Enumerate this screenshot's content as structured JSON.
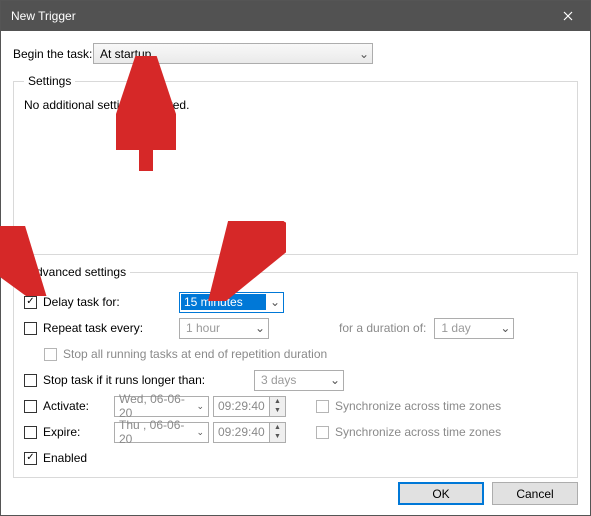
{
  "window": {
    "title": "New Trigger"
  },
  "begin": {
    "label": "Begin the task:",
    "value": "At startup"
  },
  "settings": {
    "legend": "Settings",
    "message": "No additional settings required."
  },
  "advanced": {
    "legend": "Advanced settings",
    "delay": {
      "checked": true,
      "label": "Delay task for:",
      "value": "15 minutes"
    },
    "repeat": {
      "checked": false,
      "label": "Repeat task every:",
      "value": "1 hour",
      "duration_label": "for a duration of:",
      "duration_value": "1 day"
    },
    "stop_repetition": {
      "checked": false,
      "label": "Stop all running tasks at end of repetition duration"
    },
    "stop_after": {
      "checked": false,
      "label": "Stop task if it runs longer than:",
      "value": "3 days"
    },
    "activate": {
      "checked": false,
      "label": "Activate:",
      "date": "Wed, 06-06-20",
      "time": "09:29:40",
      "sync": "Synchronize across time zones"
    },
    "expire": {
      "checked": false,
      "label": "Expire:",
      "date": "Thu , 06-06-20",
      "time": "09:29:40",
      "sync": "Synchronize across time zones"
    },
    "enabled": {
      "checked": true,
      "label": "Enabled"
    }
  },
  "buttons": {
    "ok": "OK",
    "cancel": "Cancel"
  },
  "annotations": {
    "arrow_color": "#d62828"
  }
}
